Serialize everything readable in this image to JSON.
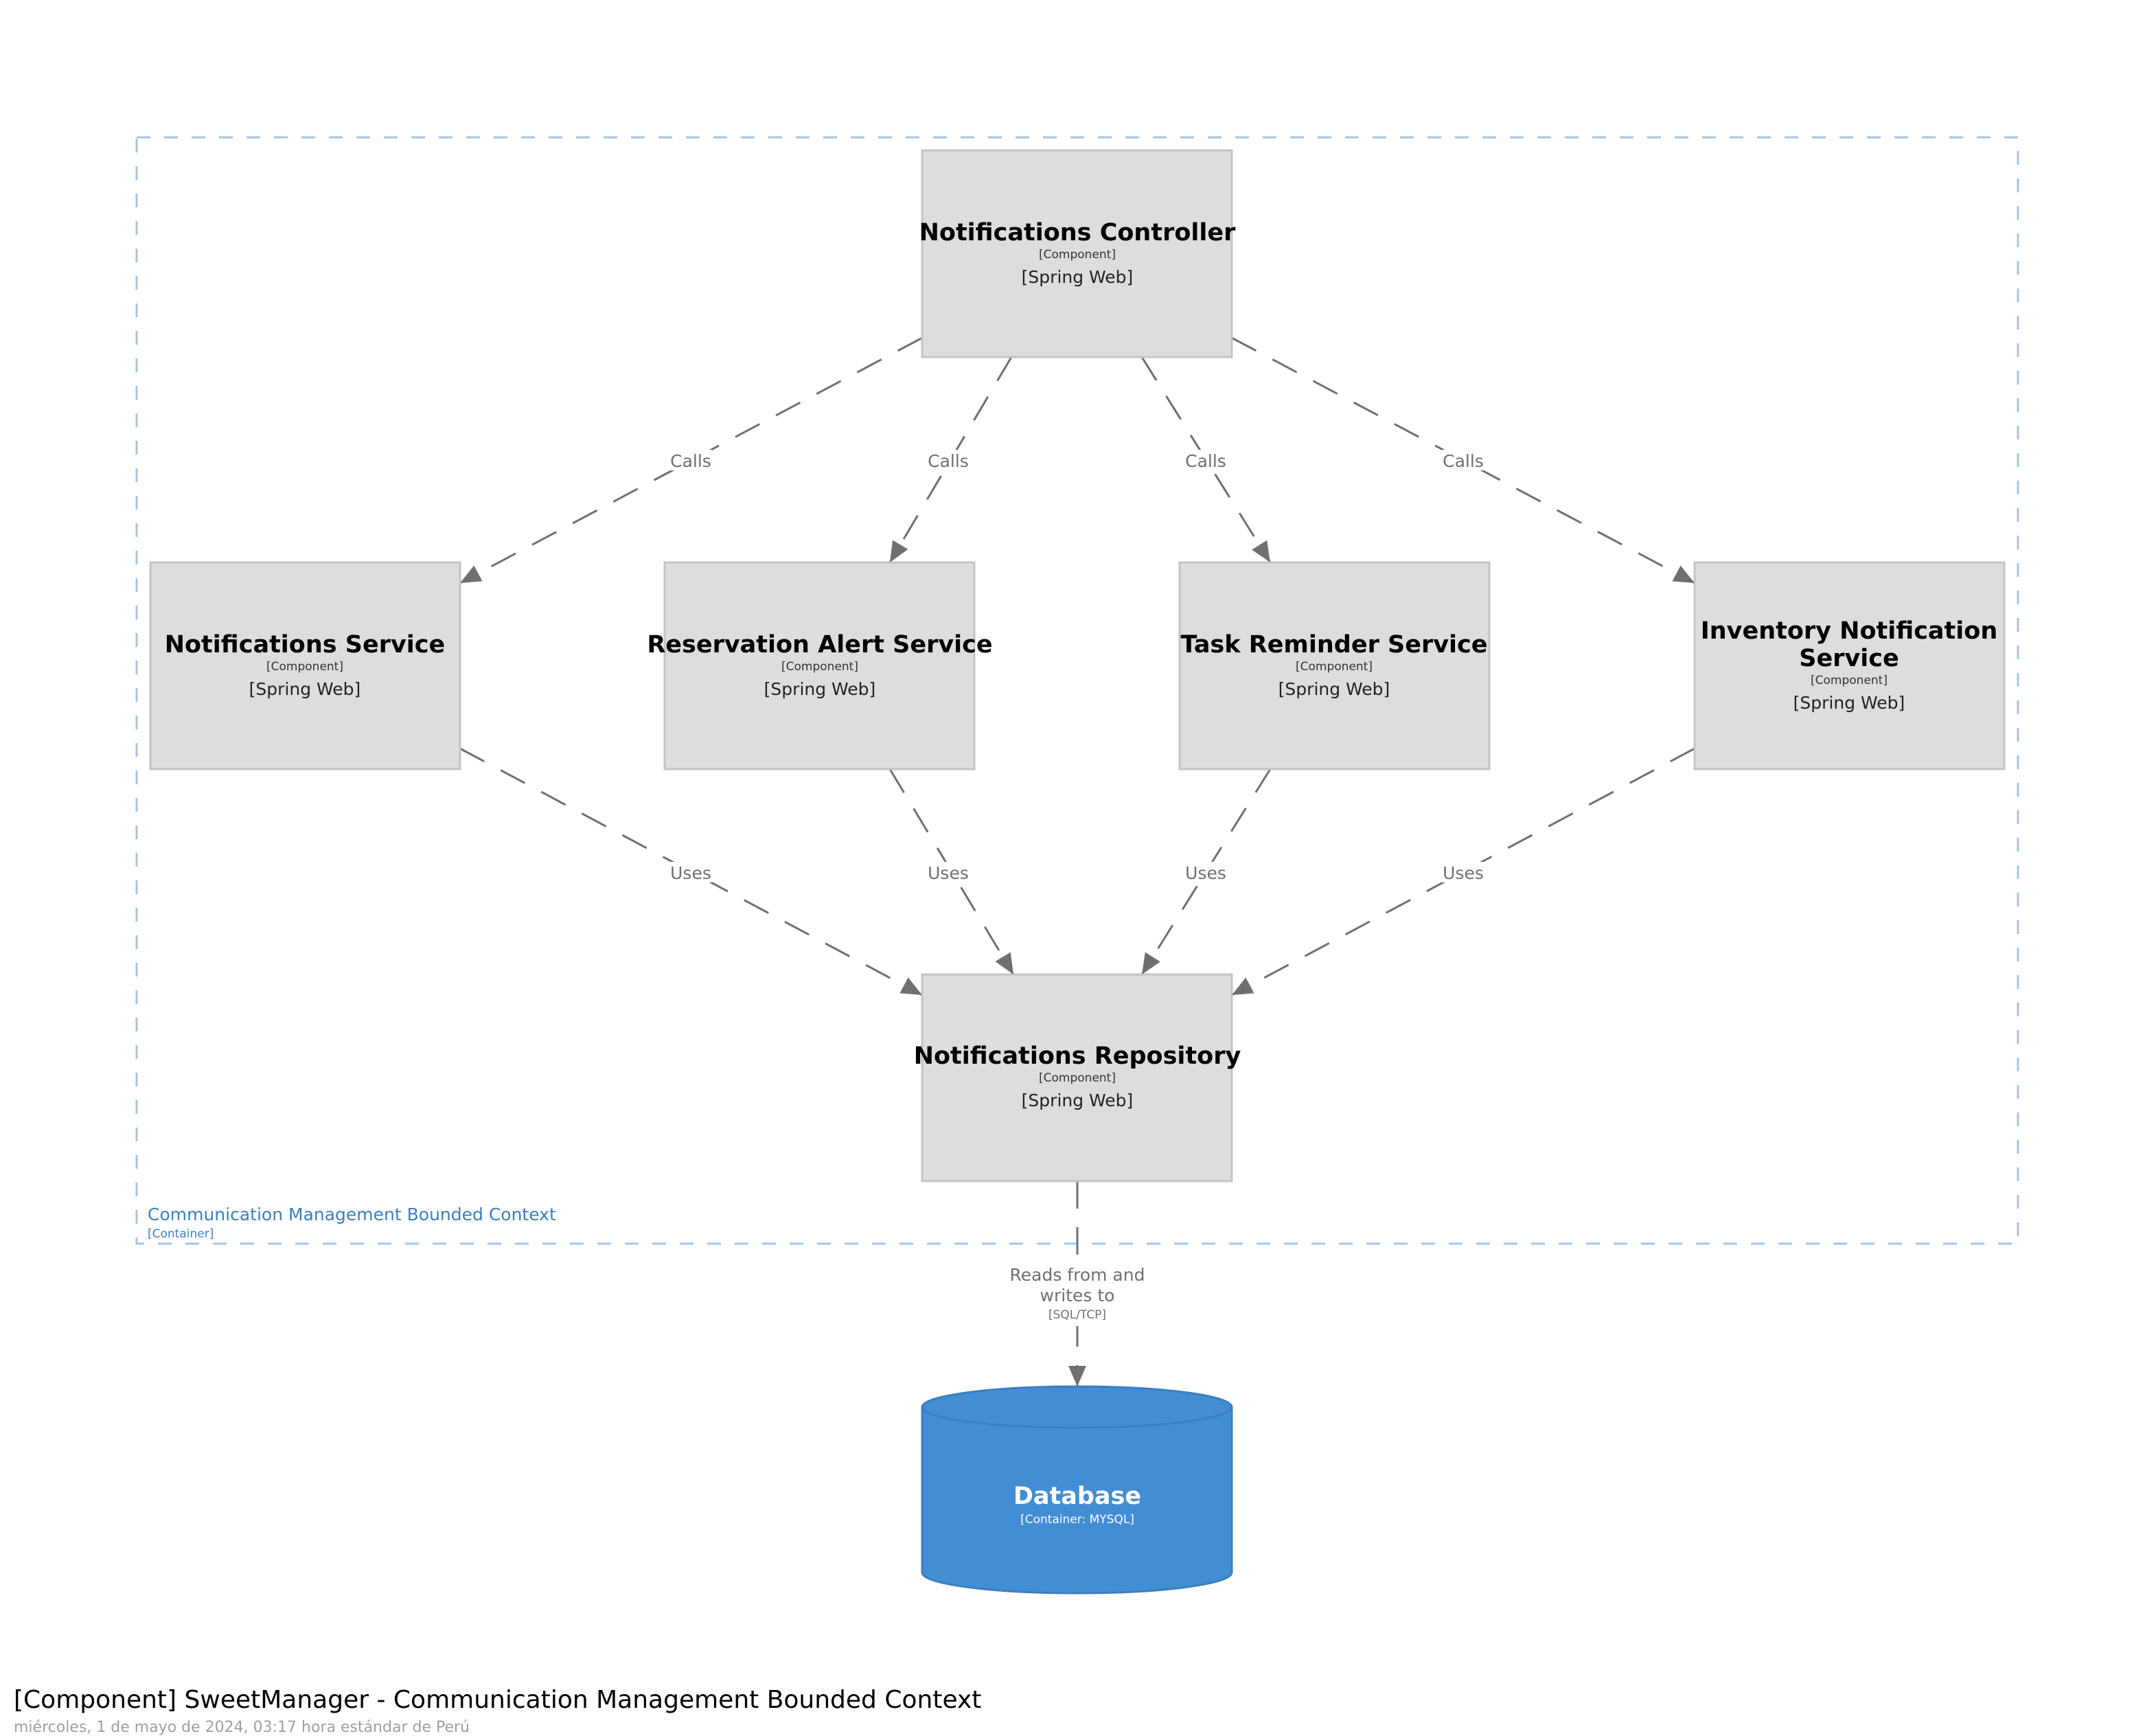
{
  "diagram": {
    "title": "[Component] SweetManager - Communication Management Bounded Context",
    "date": "miércoles, 1 de mayo de 2024, 03:17 hora estándar de Perú",
    "boundary": {
      "name": "Communication Management Bounded Context",
      "type": "[Container]",
      "color": "#a5c5e0",
      "label_color": "#3c7fc0"
    },
    "components": [
      {
        "id": "controller",
        "name": "Notifications Controller",
        "type": "[Component]",
        "tech": "[Spring Web]"
      },
      {
        "id": "notif_service",
        "name": "Notifications Service",
        "type": "[Component]",
        "tech": "[Spring Web]"
      },
      {
        "id": "reservation",
        "name": "Reservation Alert Service",
        "type": "[Component]",
        "tech": "[Spring Web]"
      },
      {
        "id": "task",
        "name": "Task Reminder Service",
        "type": "[Component]",
        "tech": "[Spring Web]"
      },
      {
        "id": "inventory",
        "name_lines": [
          "Inventory Notification",
          "Service"
        ],
        "name": "Inventory Notification Service",
        "type": "[Component]",
        "tech": "[Spring Web]"
      },
      {
        "id": "repository",
        "name": "Notifications Repository",
        "type": "[Component]",
        "tech": "[Spring Web]"
      }
    ],
    "database": {
      "name": "Database",
      "type": "[Container: MYSQL]",
      "color": "#438dd5"
    },
    "relationships": [
      {
        "from": "controller",
        "to": "notif_service",
        "label": "Calls"
      },
      {
        "from": "controller",
        "to": "reservation",
        "label": "Calls"
      },
      {
        "from": "controller",
        "to": "task",
        "label": "Calls"
      },
      {
        "from": "controller",
        "to": "inventory",
        "label": "Calls"
      },
      {
        "from": "notif_service",
        "to": "repository",
        "label": "Uses"
      },
      {
        "from": "reservation",
        "to": "repository",
        "label": "Uses"
      },
      {
        "from": "task",
        "to": "repository",
        "label": "Uses"
      },
      {
        "from": "inventory",
        "to": "repository",
        "label": "Uses"
      },
      {
        "from": "repository",
        "to": "database",
        "label_lines": [
          "Reads from and",
          "writes to"
        ],
        "label": "Reads from and writes to",
        "tech": "[SQL/TCP]"
      }
    ],
    "colors": {
      "component_fill": "#dddddd",
      "component_border": "#c4c4c4",
      "edge": "#707070"
    }
  }
}
